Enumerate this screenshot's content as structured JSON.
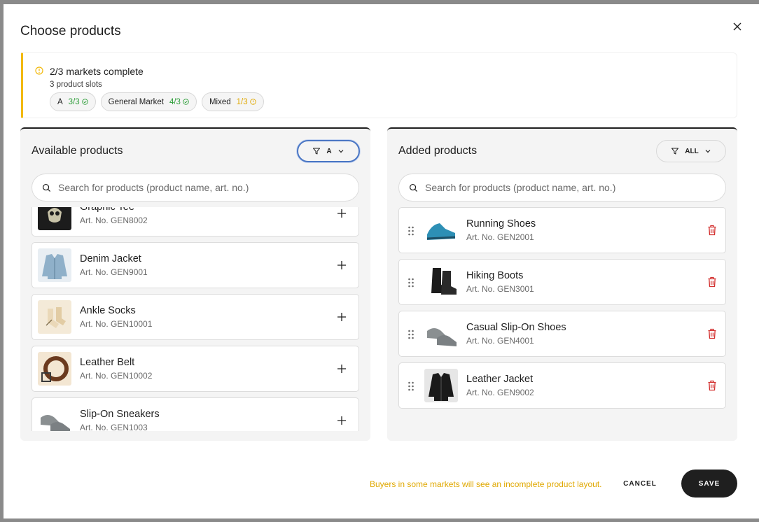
{
  "modal": {
    "title": "Choose products",
    "close_icon": "close-icon"
  },
  "banner": {
    "icon": "warning-circle-icon",
    "accent_color": "#f2b90c",
    "title": "2/3 markets complete",
    "subtitle": "3 product slots",
    "markets": [
      {
        "name": "A",
        "count": "3/3",
        "status": "complete",
        "icon": "check-circle-icon",
        "color": "#2e9e3a"
      },
      {
        "name": "General Market",
        "count": "4/3",
        "status": "complete",
        "icon": "check-circle-icon",
        "color": "#2e9e3a"
      },
      {
        "name": "Mixed",
        "count": "1/3",
        "status": "incomplete",
        "icon": "warning-circle-icon",
        "color": "#e0a800"
      }
    ]
  },
  "available": {
    "title": "Available products",
    "filter_label": "A",
    "search_placeholder": "Search for products (product name, art. no.)",
    "items": [
      {
        "name": "Graphic Tee",
        "art": "Art. No. GEN8002",
        "icon": "plus-icon"
      },
      {
        "name": "Denim Jacket",
        "art": "Art. No. GEN9001",
        "icon": "plus-icon"
      },
      {
        "name": "Ankle Socks",
        "art": "Art. No. GEN10001",
        "icon": "plus-icon"
      },
      {
        "name": "Leather Belt",
        "art": "Art. No. GEN10002",
        "icon": "plus-icon"
      },
      {
        "name": "Slip-On Sneakers",
        "art": "Art. No. GEN1003",
        "icon": "plus-icon"
      }
    ]
  },
  "added": {
    "title": "Added products",
    "filter_label": "ALL",
    "search_placeholder": "Search for products (product name, art. no.)",
    "items": [
      {
        "name": "Running Shoes",
        "art": "Art. No. GEN2001",
        "icon": "trash-icon"
      },
      {
        "name": "Hiking Boots",
        "art": "Art. No. GEN3001",
        "icon": "trash-icon"
      },
      {
        "name": "Casual Slip-On Shoes",
        "art": "Art. No. GEN4001",
        "icon": "trash-icon"
      },
      {
        "name": "Leather Jacket",
        "art": "Art. No. GEN9002",
        "icon": "trash-icon"
      }
    ]
  },
  "footer": {
    "warning": "Buyers in some markets will see an incomplete product layout.",
    "warning_color": "#e0a800",
    "cancel_label": "CANCEL",
    "save_label": "SAVE"
  }
}
